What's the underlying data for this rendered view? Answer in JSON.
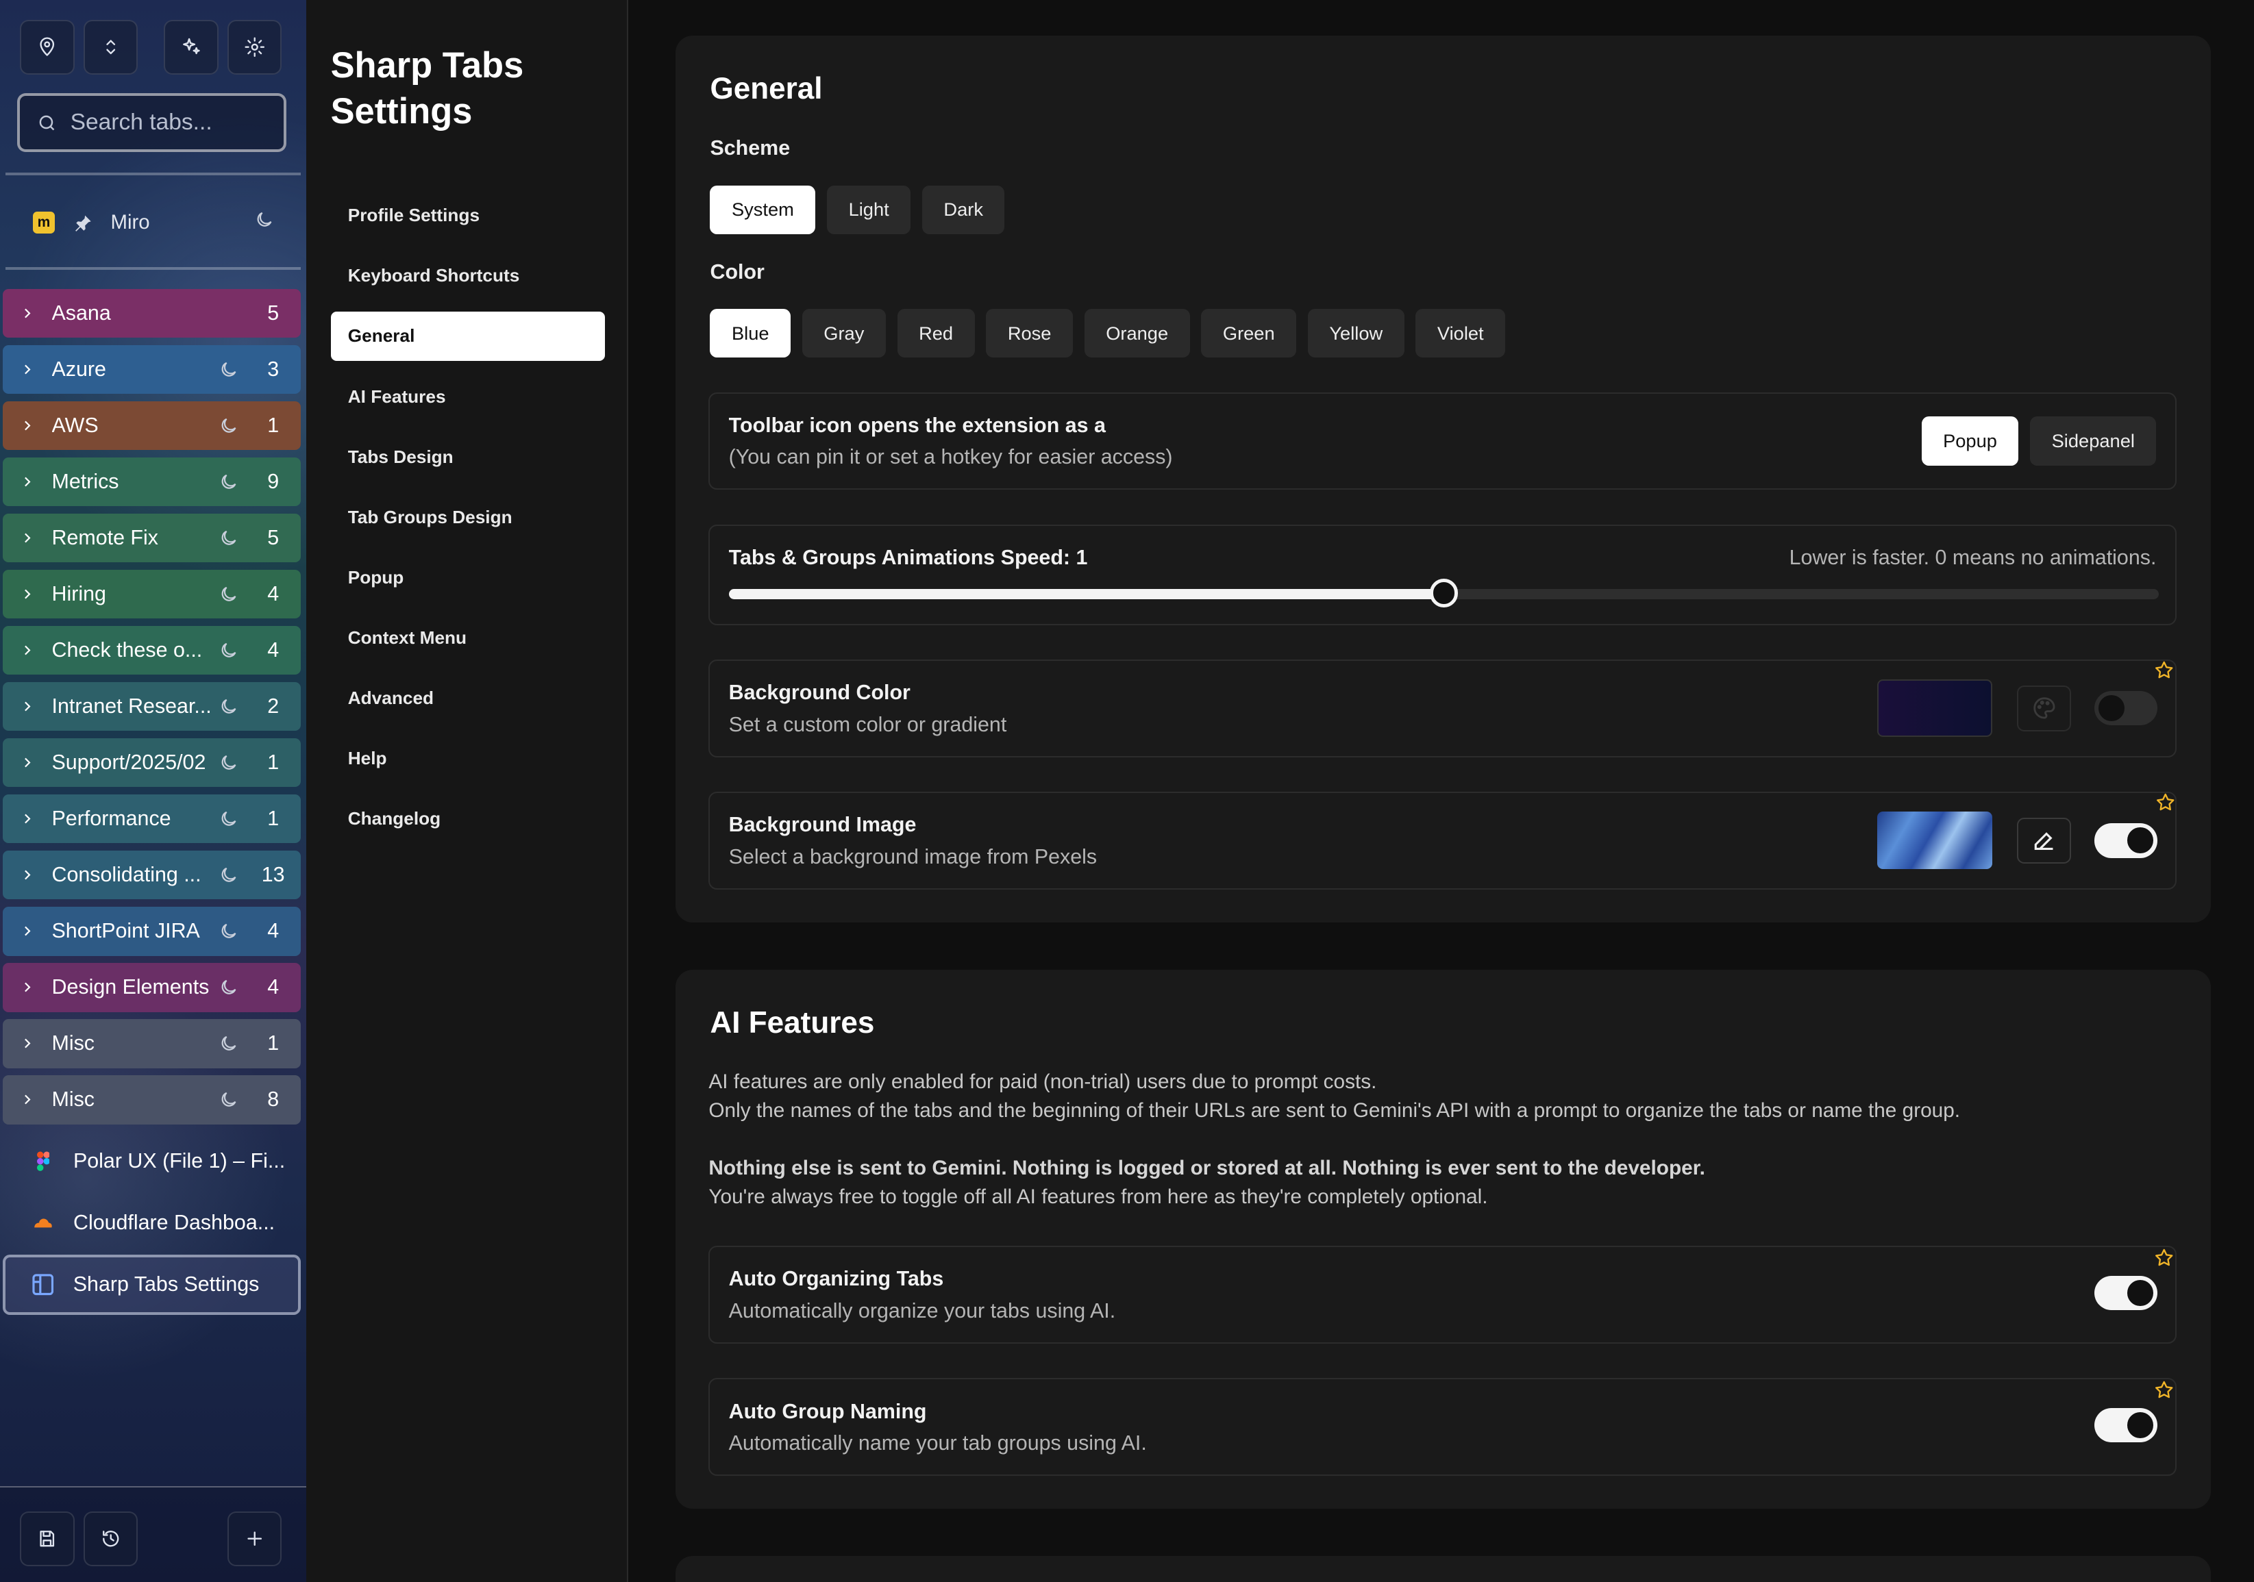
{
  "tabbar": {
    "search_placeholder": "Search tabs...",
    "pinned": {
      "label": "Miro"
    },
    "groups": [
      {
        "label": "Asana",
        "count": "5",
        "color": "#7a2f66",
        "moon": false
      },
      {
        "label": "Azure",
        "count": "3",
        "color": "#2e5f91",
        "moon": true
      },
      {
        "label": "AWS",
        "count": "1",
        "color": "#7c4a34",
        "moon": true
      },
      {
        "label": "Metrics",
        "count": "9",
        "color": "#2f6a55",
        "moon": true
      },
      {
        "label": "Remote Fix",
        "count": "5",
        "color": "#316a52",
        "moon": true
      },
      {
        "label": "Hiring",
        "count": "4",
        "color": "#2f6a4e",
        "moon": true
      },
      {
        "label": "Check these o...",
        "count": "4",
        "color": "#2d6a56",
        "moon": true
      },
      {
        "label": "Intranet Resear...",
        "count": "2",
        "color": "#2d6068",
        "moon": true
      },
      {
        "label": "Support/2025/02",
        "count": "1",
        "color": "#2d6066",
        "moon": true
      },
      {
        "label": "Performance",
        "count": "1",
        "color": "#2e6070",
        "moon": true
      },
      {
        "label": "Consolidating ...",
        "count": "13",
        "color": "#2d5e76",
        "moon": true
      },
      {
        "label": "ShortPoint JIRA",
        "count": "4",
        "color": "#2e5a85",
        "moon": true
      },
      {
        "label": "Design Elements",
        "count": "4",
        "color": "#6a2f66",
        "moon": true
      },
      {
        "label": "Misc",
        "count": "1",
        "color": "#4a5266",
        "moon": true
      },
      {
        "label": "Misc",
        "count": "8",
        "color": "#4a5266",
        "moon": true
      }
    ],
    "tabs": [
      {
        "label": "Polar UX (File 1) – Fi...",
        "icon": "figma-icon"
      },
      {
        "label": "Cloudflare Dashboa...",
        "icon": "cloudflare-icon"
      },
      {
        "label": "Sharp Tabs Settings",
        "icon": "sharp-tabs-icon"
      }
    ]
  },
  "nav": {
    "title": "Sharp Tabs Settings",
    "items": [
      "Profile Settings",
      "Keyboard Shortcuts",
      "General",
      "AI Features",
      "Tabs Design",
      "Tab Groups Design",
      "Popup",
      "Context Menu",
      "Advanced",
      "Help",
      "Changelog"
    ],
    "active": "General"
  },
  "general": {
    "title": "General",
    "scheme_label": "Scheme",
    "scheme_options": [
      "System",
      "Light",
      "Dark"
    ],
    "scheme_selected": "System",
    "color_label": "Color",
    "color_options": [
      "Blue",
      "Gray",
      "Red",
      "Rose",
      "Orange",
      "Green",
      "Yellow",
      "Violet"
    ],
    "color_selected": "Blue",
    "toolbar": {
      "title": "Toolbar icon opens the extension as a",
      "subtitle": "(You can pin it or set a hotkey for easier access)",
      "options": [
        "Popup",
        "Sidepanel"
      ],
      "selected": "Popup"
    },
    "animation": {
      "title": "Tabs & Groups Animations Speed: 1",
      "hint": "Lower is faster. 0 means no animations.",
      "value_fraction": 0.5
    },
    "bg_color": {
      "title": "Background Color",
      "subtitle": "Set a custom color or gradient",
      "enabled": false,
      "swatch": "#1a0f3a"
    },
    "bg_image": {
      "title": "Background Image",
      "subtitle": "Select a background image from Pexels",
      "enabled": true
    }
  },
  "ai": {
    "title": "AI Features",
    "p1": "AI features are only enabled for paid (non-trial) users due to prompt costs.",
    "p2": "Only the names of the tabs and the beginning of their URLs are sent to Gemini's API with a prompt to organize the tabs or name the group.",
    "p3": "Nothing else is sent to Gemini. Nothing is logged or stored at all. Nothing is ever sent to the developer.",
    "p4": "You're always free to toggle off all AI features from here as they're completely optional.",
    "auto_org": {
      "title": "Auto Organizing Tabs",
      "subtitle": "Automatically organize your tabs using AI.",
      "enabled": true
    },
    "auto_name": {
      "title": "Auto Group Naming",
      "subtitle": "Automatically name your tab groups using AI.",
      "enabled": true
    }
  },
  "colors": {
    "accent": "#ffffff",
    "star": "#f0b429",
    "panel": "#1a1a1a"
  }
}
